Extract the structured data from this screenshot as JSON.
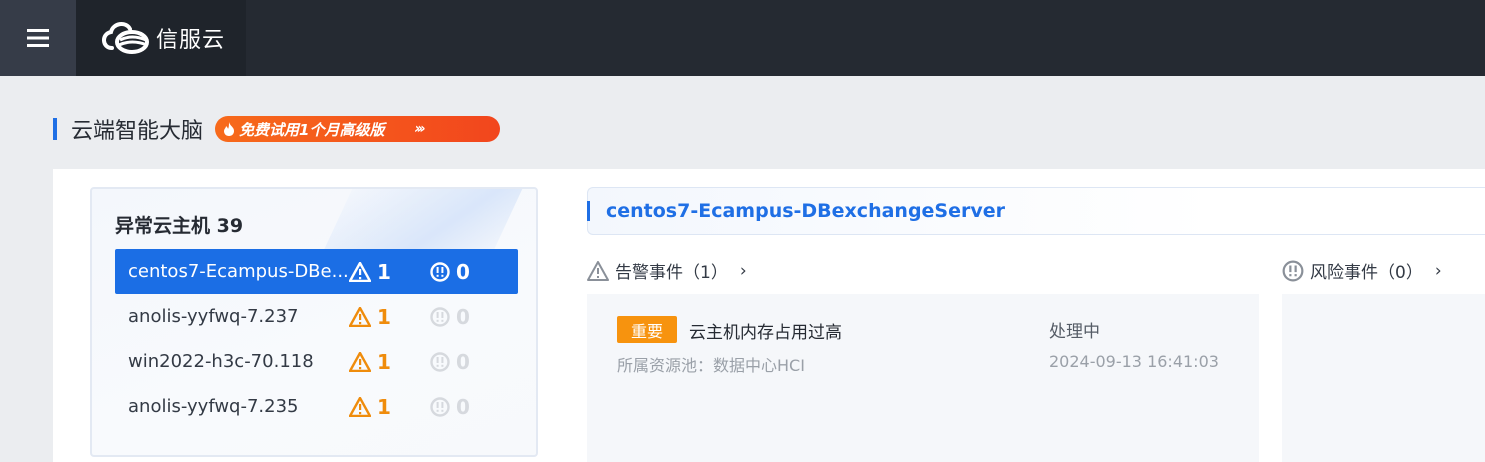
{
  "header": {
    "logo_text": "信服云",
    "menu_icon": "hamburger-menu-icon",
    "logo_icon": "cloud-logo-icon"
  },
  "section": {
    "title": "云端智能大脑",
    "trial_badge": "免费试用1个月高级版",
    "trial_chevrons": "›››",
    "fire_icon": "fire-icon"
  },
  "vm_list": {
    "title": "异常云主机 39",
    "partial_top_alarm": "1",
    "items": [
      {
        "name": "centos7-Ecampus-DBe...",
        "alarm_count": "1",
        "risk_count": "0",
        "selected": true
      },
      {
        "name": "anolis-yyfwq-7.237",
        "alarm_count": "1",
        "risk_count": "0",
        "selected": false
      },
      {
        "name": "win2022-h3c-70.118",
        "alarm_count": "1",
        "risk_count": "0",
        "selected": false
      },
      {
        "name": "anolis-yyfwq-7.235",
        "alarm_count": "1",
        "risk_count": "0",
        "selected": false
      }
    ]
  },
  "detail": {
    "vm_name": "centos7-Ecampus-DBexchangeServer",
    "alarm_events_label": "告警事件（1）",
    "risk_events_label": "风险事件（0）",
    "chevron": "›",
    "event": {
      "severity": "重要",
      "title": "云主机内存占用过高",
      "status": "处理中",
      "pool": "所属资源池：数据中心HCI",
      "time": "2024-09-13 16:41:03"
    }
  },
  "colors": {
    "accent": "#1f6fe5",
    "warning": "#ef8c0c",
    "severity_tag": "#f7930e",
    "topbar": "#252a32"
  }
}
